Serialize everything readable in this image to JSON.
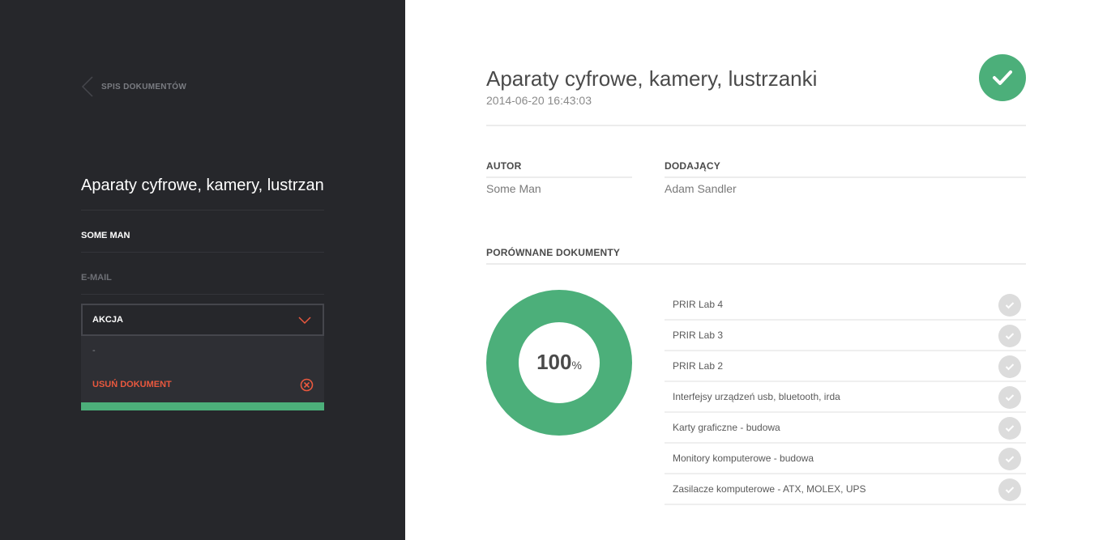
{
  "sidebar": {
    "back_label": "SPIS DOKUMENTÓW",
    "doc_title": "Aparaty cyfrowe, kamery, lustrzanki",
    "author_name": "SOME MAN",
    "email_label": "E-MAIL",
    "action_label": "AKCJA",
    "dropdown_items": [
      "-",
      "USUŃ DOKUMENT"
    ]
  },
  "main": {
    "title": "Aparaty cyfrowe, kamery, lustrzanki",
    "date": "2014-06-20 16:43:03",
    "author_header": "AUTOR",
    "author_value": "Some Man",
    "adder_header": "DODAJĄCY",
    "adder_value": "Adam Sandler",
    "compared_header": "PORÓWNANE DOKUMENTY",
    "similarity_value": "100",
    "similarity_unit": "%",
    "compared_docs": [
      "PRIR Lab 4",
      "PRIR Lab 3",
      "PRIR Lab 2",
      "Interfejsy urządzeń usb, bluetooth, irda",
      "Karty graficzne - budowa",
      "Monitory komputerowe - budowa",
      "Zasilacze komputerowe - ATX, MOLEX, UPS"
    ]
  },
  "colors": {
    "sidebar_bg": "#26272b",
    "accent_green": "#4caf7a",
    "danger_red": "#e9583e",
    "check_grey": "#dcdcdc"
  }
}
